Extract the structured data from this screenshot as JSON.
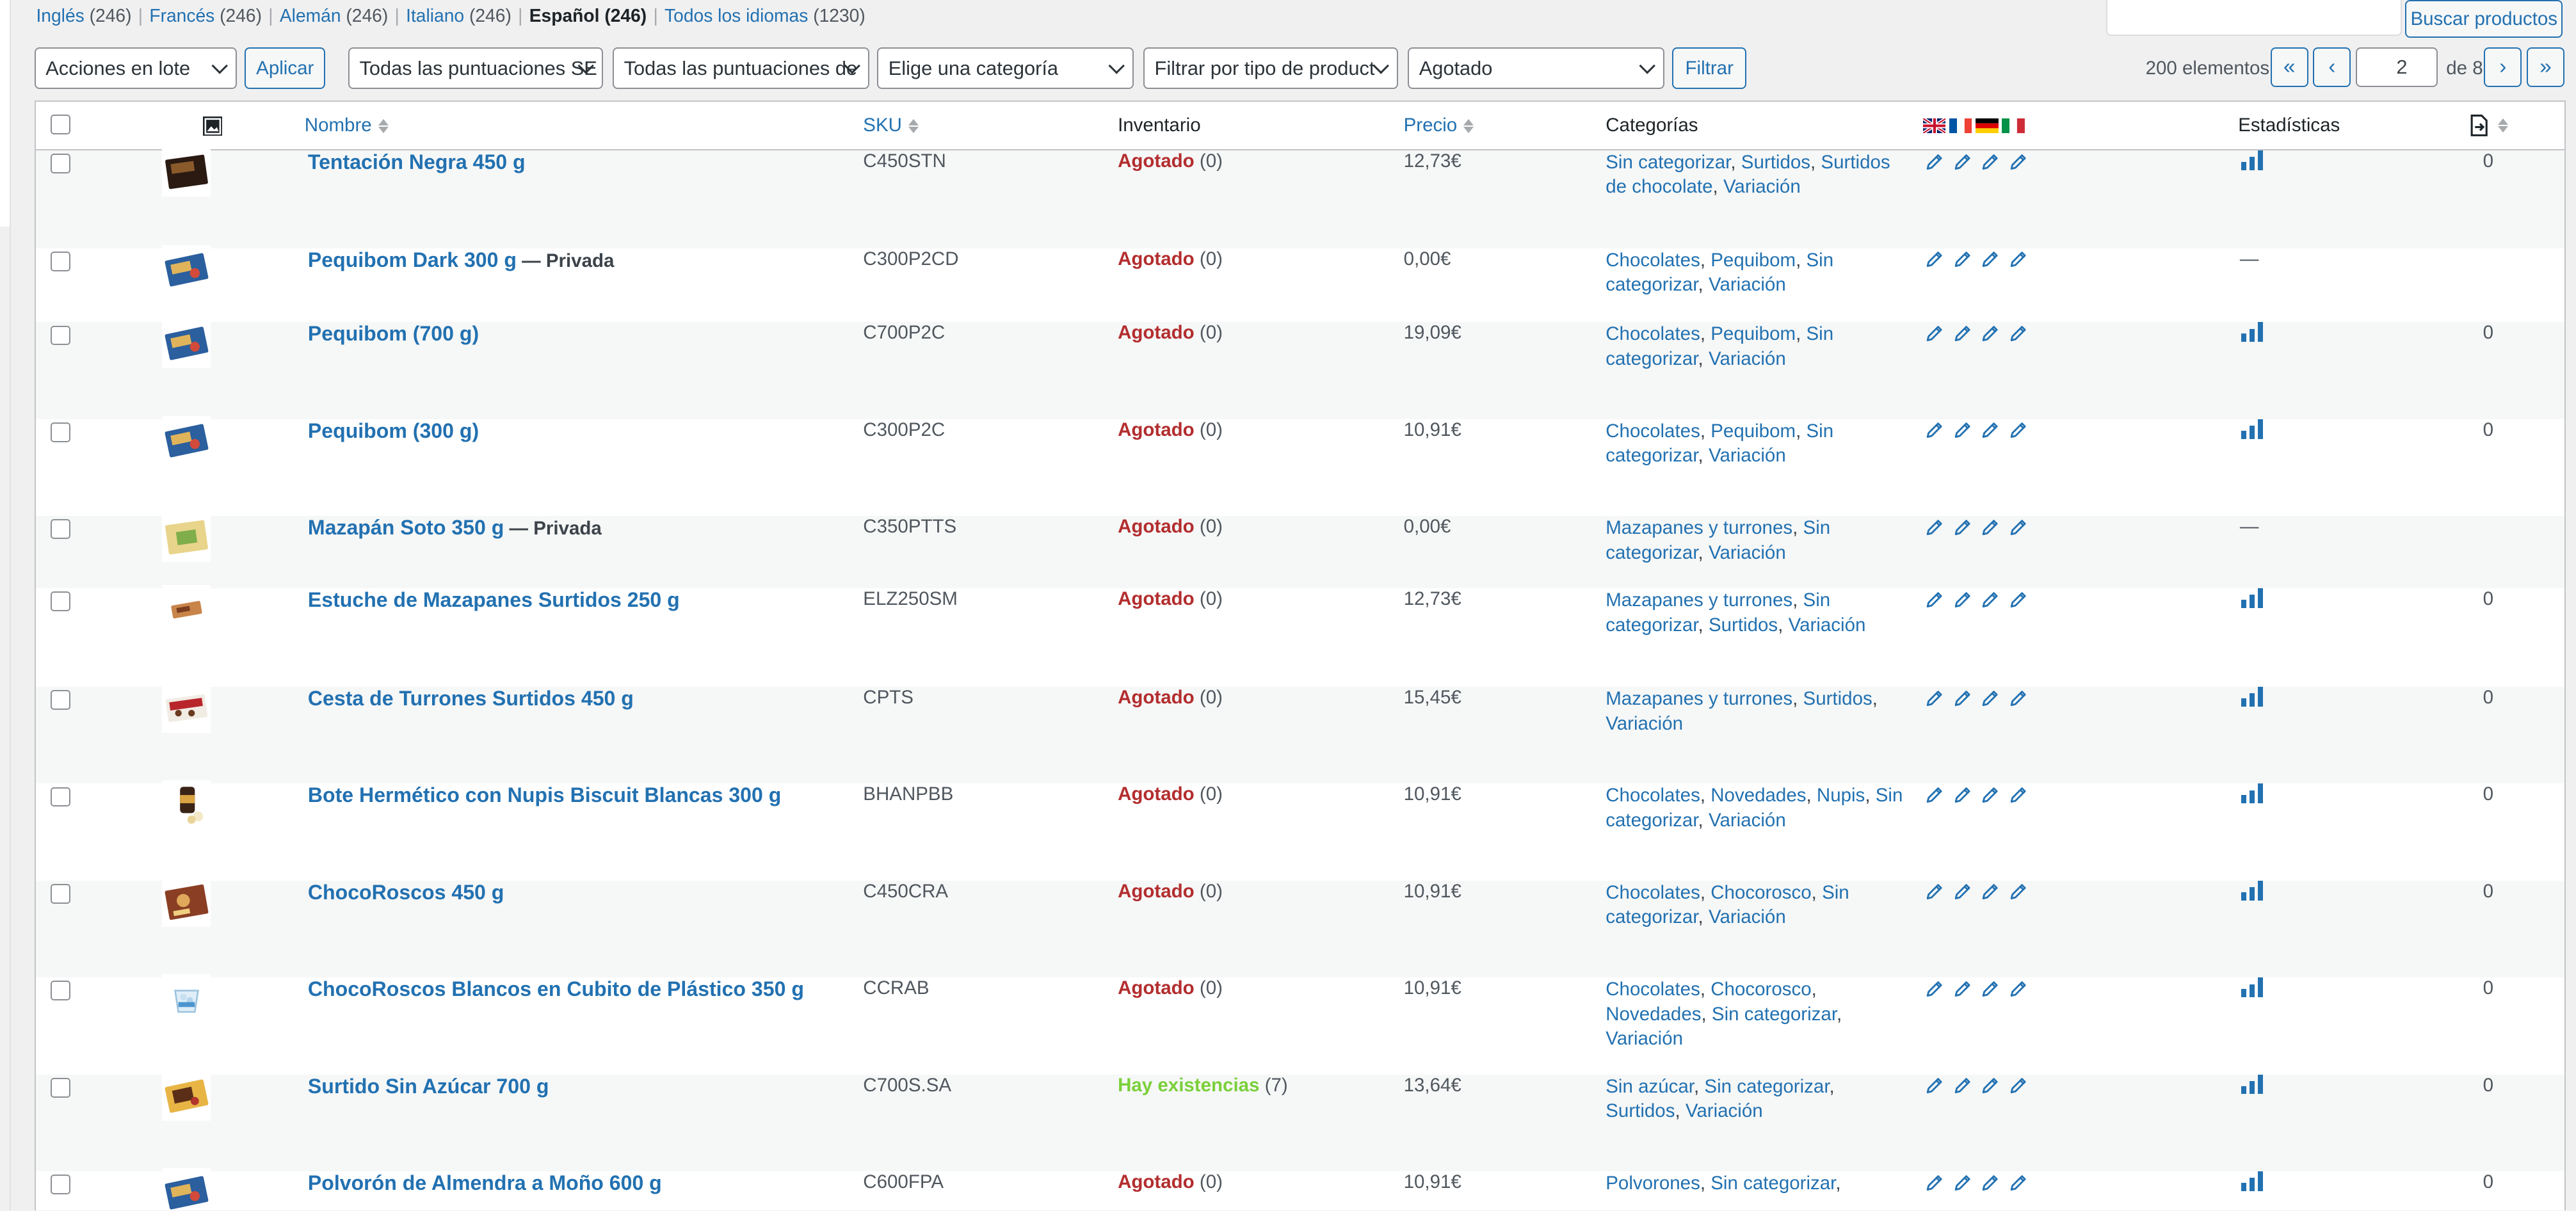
{
  "languages": [
    {
      "label": "Inglés",
      "count": "(246)"
    },
    {
      "label": "Francés",
      "count": "(246)"
    },
    {
      "label": "Alemán",
      "count": "(246)"
    },
    {
      "label": "Italiano",
      "count": "(246)"
    },
    {
      "label": "Español",
      "count": "(246)",
      "current": true
    },
    {
      "label": "Todos los idiomas",
      "count": "(1230)"
    }
  ],
  "search": {
    "button": "Buscar productos",
    "value": ""
  },
  "toolbar": {
    "bulk_actions": "Acciones en lote",
    "apply": "Aplicar",
    "rating1": "Todas las puntuaciones SE",
    "rating2": "Todas las puntuaciones de",
    "category": "Elige una categoría",
    "product_type": "Filtrar por tipo de product",
    "stock": "Agotado",
    "filter": "Filtrar"
  },
  "pagination": {
    "count": "200 elementos",
    "first": "«",
    "prev": "‹",
    "current": "2",
    "of": "de 8",
    "next": "›",
    "last": "»"
  },
  "columns": {
    "name": "Nombre",
    "sku": "SKU",
    "inventory": "Inventario",
    "price": "Precio",
    "categories": "Categorías",
    "stats": "Estadísticas"
  },
  "colors": {
    "link": "#2271b1",
    "out_of_stock": "#b32d2e",
    "in_stock": "#7ad03a"
  },
  "rows": [
    {
      "name": "Tentación Negra 450 g",
      "private": "",
      "sku": "C450STN",
      "stock_label": "Agotado",
      "stock_qty": "(0)",
      "in_stock": false,
      "price": "12,73€",
      "categories": [
        "Sin categorizar",
        "Surtidos",
        "Surtidos de chocolate",
        "Variación"
      ],
      "stats": true,
      "views": "0",
      "thumb": "dark-box"
    },
    {
      "name": "Pequibom Dark 300 g",
      "private": "— Privada",
      "sku": "C300P2CD",
      "stock_label": "Agotado",
      "stock_qty": "(0)",
      "in_stock": false,
      "price": "0,00€",
      "categories": [
        "Chocolates",
        "Pequibom",
        "Sin categorizar",
        "Variación"
      ],
      "stats": false,
      "views": "",
      "thumb": "blue-box"
    },
    {
      "name": "Pequibom (700 g)",
      "private": "",
      "sku": "C700P2C",
      "stock_label": "Agotado",
      "stock_qty": "(0)",
      "in_stock": false,
      "price": "19,09€",
      "categories": [
        "Chocolates",
        "Pequibom",
        "Sin categorizar",
        "Variación"
      ],
      "stats": true,
      "views": "0",
      "thumb": "blue-box"
    },
    {
      "name": "Pequibom (300 g)",
      "private": "",
      "sku": "C300P2C",
      "stock_label": "Agotado",
      "stock_qty": "(0)",
      "in_stock": false,
      "price": "10,91€",
      "categories": [
        "Chocolates",
        "Pequibom",
        "Sin categorizar",
        "Variación"
      ],
      "stats": true,
      "views": "0",
      "thumb": "blue-box"
    },
    {
      "name": "Mazapán Soto 350 g",
      "private": "— Privada",
      "sku": "C350PTTS",
      "stock_label": "Agotado",
      "stock_qty": "(0)",
      "in_stock": false,
      "price": "0,00€",
      "categories": [
        "Mazapanes y turrones",
        "Sin categorizar",
        "Variación"
      ],
      "stats": false,
      "views": "",
      "thumb": "yellow-box"
    },
    {
      "name": "Estuche de Mazapanes Surtidos 250 g",
      "private": "",
      "sku": "ELZ250SM",
      "stock_label": "Agotado",
      "stock_qty": "(0)",
      "in_stock": false,
      "price": "12,73€",
      "categories": [
        "Mazapanes y turrones",
        "Sin categorizar",
        "Surtidos",
        "Variación"
      ],
      "stats": true,
      "views": "0",
      "thumb": "small-tray"
    },
    {
      "name": "Cesta de Turrones Surtidos 450 g",
      "private": "",
      "sku": "CPTS",
      "stock_label": "Agotado",
      "stock_qty": "(0)",
      "in_stock": false,
      "price": "15,45€",
      "categories": [
        "Mazapanes y turrones",
        "Surtidos",
        "Variación"
      ],
      "stats": true,
      "views": "0",
      "thumb": "red-box"
    },
    {
      "name": "Bote Hermético con Nupis Biscuit Blancas 300 g",
      "private": "",
      "sku": "BHANPBB",
      "stock_label": "Agotado",
      "stock_qty": "(0)",
      "in_stock": false,
      "price": "10,91€",
      "categories": [
        "Chocolates",
        "Novedades",
        "Nupis",
        "Sin categorizar",
        "Variación"
      ],
      "stats": true,
      "views": "0",
      "thumb": "jar"
    },
    {
      "name": "ChocoRoscos 450 g",
      "private": "",
      "sku": "C450CRA",
      "stock_label": "Agotado",
      "stock_qty": "(0)",
      "in_stock": false,
      "price": "10,91€",
      "categories": [
        "Chocolates",
        "Chocorosco",
        "Sin categorizar",
        "Variación"
      ],
      "stats": true,
      "views": "0",
      "thumb": "brown-box"
    },
    {
      "name": "ChocoRoscos Blancos en Cubito de Plástico 350 g",
      "private": "",
      "sku": "CCRAB",
      "stock_label": "Agotado",
      "stock_qty": "(0)",
      "in_stock": false,
      "price": "10,91€",
      "categories": [
        "Chocolates",
        "Chocorosco",
        "Novedades",
        "Sin categorizar",
        "Variación"
      ],
      "stats": true,
      "views": "0",
      "thumb": "cup"
    },
    {
      "name": "Surtido Sin Azúcar 700 g",
      "private": "",
      "sku": "C700S.SA",
      "stock_label": "Hay existencias",
      "stock_qty": "(7)",
      "in_stock": true,
      "price": "13,64€",
      "categories": [
        "Sin azúcar",
        "Sin categorizar",
        "Surtidos",
        "Variación"
      ],
      "stats": true,
      "views": "0",
      "thumb": "gold-box"
    },
    {
      "name": "Polvorón de Almendra a Moño 600 g",
      "private": "",
      "sku": "C600FPA",
      "stock_label": "Agotado",
      "stock_qty": "(0)",
      "in_stock": false,
      "price": "10,91€",
      "categories": [
        "Polvorones",
        "Sin categorizar"
      ],
      "categories_trailing": ",",
      "stats": true,
      "views": "0",
      "thumb": "blue-box"
    }
  ]
}
